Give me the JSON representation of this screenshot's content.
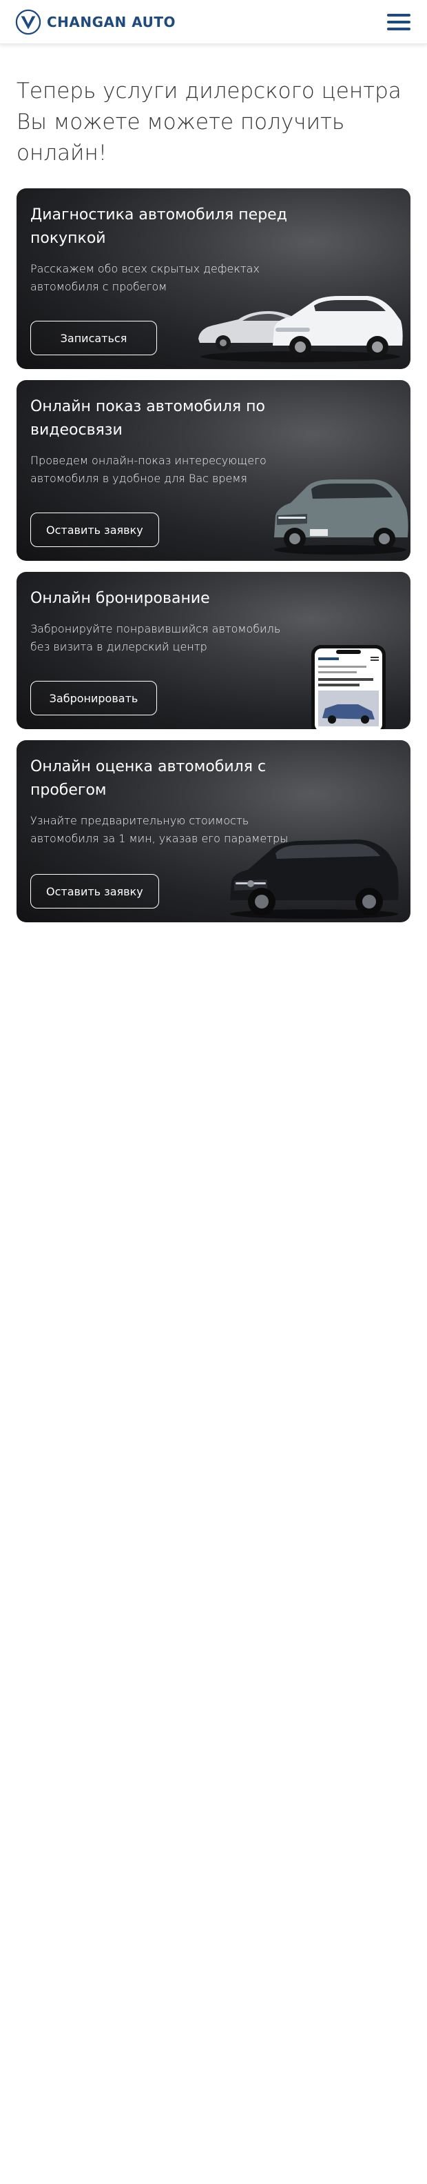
{
  "header": {
    "brand_name": "CHANGAN AUTO",
    "brand_color": "#1e4a7f",
    "logo_icon": "changan-v-logo",
    "menu_icon": "hamburger-menu-icon"
  },
  "intro": {
    "text": "Теперь услуги дилерского центра Вы можете можете получить онлайн!"
  },
  "cards": [
    {
      "title": "Диагностика автомобиля перед покупкой",
      "text": "Расскажем обо всех скрытых дефектах автомобиля с пробегом",
      "button": "Записаться",
      "image": "two-cars-image"
    },
    {
      "title": "Онлайн показ автомобиля по видеосвязи",
      "text": "Проведем онлайн-показ интересующего автомобиля в удобное для Вас время",
      "button": "Оставить заявку",
      "image": "suv-image"
    },
    {
      "title": "Онлайн бронирование",
      "text": "Забронируйте понравившийся автомобиль без визита в дилерский центр",
      "button": "Забронировать",
      "image": "smartphone-image"
    },
    {
      "title": "Онлайн оценка автомобиля с пробегом",
      "text": "Узнайте предварительную стоимость автомобиля за 1 мин, указав его параметры",
      "button": "Оставить заявку",
      "image": "black-suv-image"
    }
  ],
  "colors": {
    "card_background": "#2a2b2e",
    "page_background": "#ffffff",
    "text": "#333333"
  }
}
